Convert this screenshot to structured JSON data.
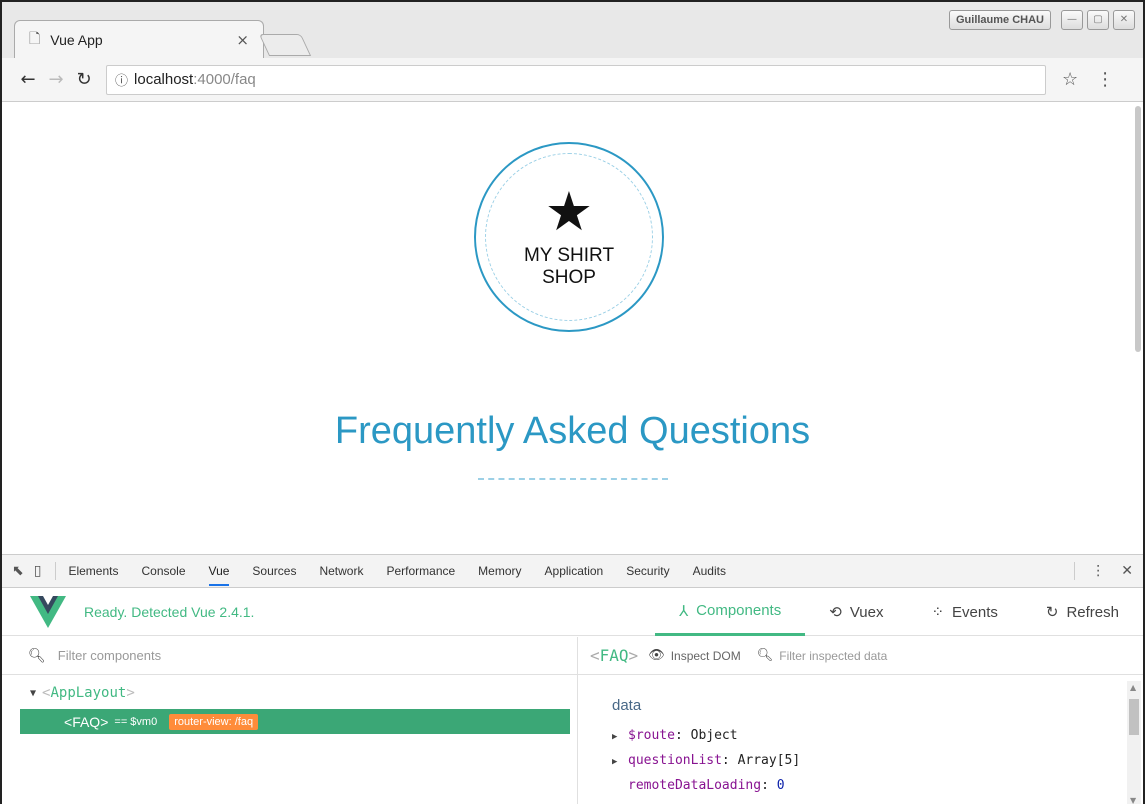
{
  "browser": {
    "tab_title": "Vue App",
    "tab_close": "×",
    "user_name": "Guillaume CHAU",
    "window_buttons": [
      "—",
      "▢",
      "✕"
    ],
    "url_host": "localhost",
    "url_path": ":4000/faq"
  },
  "page": {
    "logo_line1": "MY SHIRT",
    "logo_line2": "SHOP",
    "heading": "Frequently Asked Questions"
  },
  "devtools": {
    "tabs": [
      "Elements",
      "Console",
      "Vue",
      "Sources",
      "Network",
      "Performance",
      "Memory",
      "Application",
      "Security",
      "Audits"
    ],
    "active_tab": "Vue"
  },
  "vue": {
    "status": "Ready. Detected Vue 2.4.1.",
    "nav": {
      "components": "Components",
      "vuex": "Vuex",
      "events": "Events",
      "refresh": "Refresh"
    },
    "filter_placeholder": "Filter components",
    "tree": {
      "root_name": "AppLayout",
      "child_name": "FAQ",
      "child_vm": "== $vm0",
      "child_badge": "router-view: /faq"
    },
    "inspector": {
      "component": "FAQ",
      "inspect_dom": "Inspect DOM",
      "filter_placeholder": "Filter inspected data",
      "section": "data",
      "props": [
        {
          "key": "$route",
          "value": "Object"
        },
        {
          "key": "questionList",
          "value": "Array[5]"
        },
        {
          "key": "remoteDataLoading",
          "value": "0"
        }
      ]
    }
  },
  "colors": {
    "vue_green": "#42b983",
    "shop_blue": "#2b98c4",
    "badge_orange": "#ff8c3a"
  }
}
